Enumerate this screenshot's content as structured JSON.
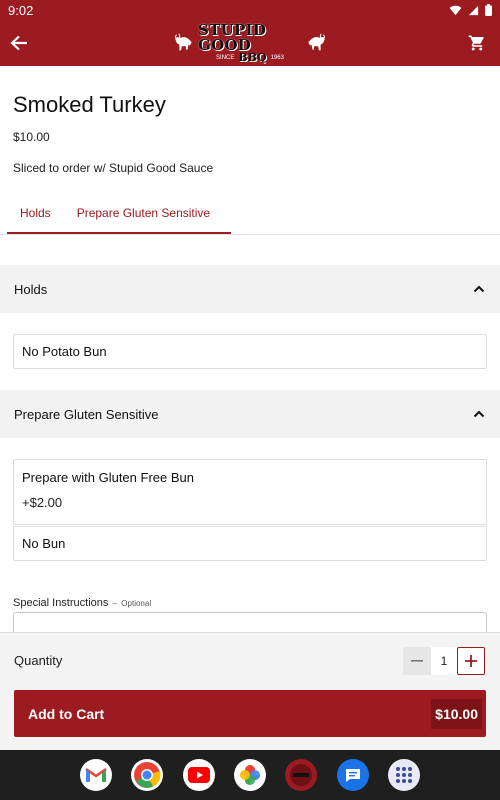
{
  "status": {
    "time": "9:02"
  },
  "app_bar": {
    "logo_main": "STUPID GOOD",
    "logo_since": "SINCE",
    "logo_year": "1963",
    "logo_bbq": "BBQ"
  },
  "item": {
    "title": "Smoked Turkey",
    "price": "$10.00",
    "description": "Sliced to order w/ Stupid Good Sauce"
  },
  "tabs": [
    {
      "label": "Holds"
    },
    {
      "label": "Prepare Gluten Sensitive"
    }
  ],
  "sections": [
    {
      "title": "Holds",
      "options": [
        {
          "name": "No Potato Bun"
        }
      ]
    },
    {
      "title": "Prepare Gluten Sensitive",
      "options": [
        {
          "name": "Prepare with Gluten Free Bun",
          "extra": "+$2.00"
        },
        {
          "name": "No Bun"
        }
      ]
    }
  ],
  "instructions": {
    "label": "Special Instructions",
    "dash": " – ",
    "optional": "Optional"
  },
  "order": {
    "quantity_label": "Quantity",
    "quantity": "1",
    "add_label": "Add to Cart",
    "total": "$10.00"
  },
  "dock_apps": [
    "gmail-icon",
    "chrome-icon",
    "youtube-icon",
    "photos-icon",
    "stupid-good-app-icon",
    "messages-icon",
    "app-drawer-icon"
  ],
  "colors": {
    "brand": "#9b1b20",
    "brand_dark": "#7d1217",
    "section_bg": "#f2f2f2"
  }
}
